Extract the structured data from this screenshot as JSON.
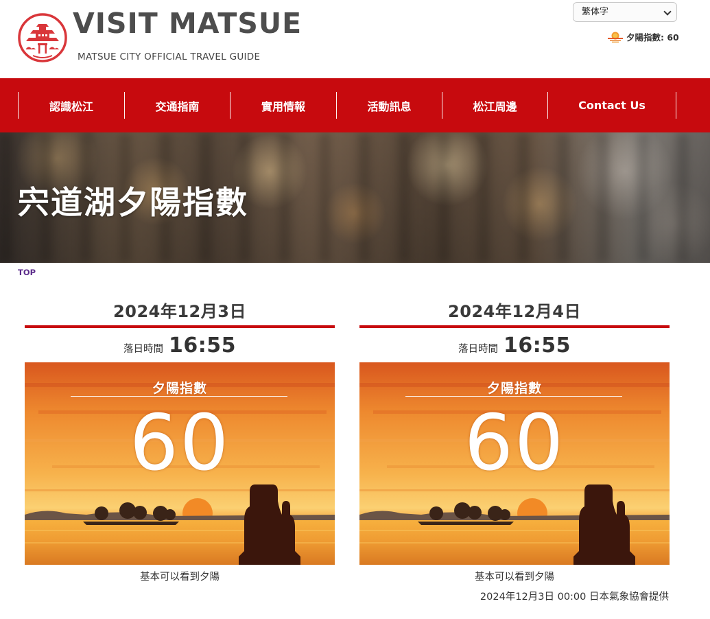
{
  "header": {
    "site_title": "VISIT MATSUE",
    "site_subtitle": "MATSUE CITY OFFICIAL TRAVEL GUIDE",
    "language_selected": "繁体字",
    "sunset_index_label": "夕陽指數: 60"
  },
  "nav": {
    "items": [
      {
        "label": "認識松江"
      },
      {
        "label": "交通指南"
      },
      {
        "label": "實用情報"
      },
      {
        "label": "活動訊息"
      },
      {
        "label": "松江周邊"
      },
      {
        "label": "Contact Us"
      }
    ]
  },
  "hero": {
    "title": "宍道湖夕陽指數"
  },
  "breadcrumb": {
    "top": "TOP"
  },
  "days": [
    {
      "date": "2024年12月3日",
      "sunset_label": "落日時間",
      "sunset_time": "16:55",
      "index_label": "夕陽指數",
      "index_value": "60",
      "caption": "基本可以看到夕陽"
    },
    {
      "date": "2024年12月4日",
      "sunset_label": "落日時間",
      "sunset_time": "16:55",
      "index_label": "夕陽指數",
      "index_value": "60",
      "caption": "基本可以看到夕陽"
    }
  ],
  "source_note": "2024年12月3日 00:00 日本氣象協會提供",
  "colors": {
    "brand_red": "#c70a0e",
    "title_gray": "#4d4d4d",
    "breadcrumb_purple": "#5a2a8a"
  },
  "icons": {
    "logo": "matsue-castle-logo",
    "language_chevron": "chevron-down-icon",
    "sunset_index": "sunset-icon"
  }
}
